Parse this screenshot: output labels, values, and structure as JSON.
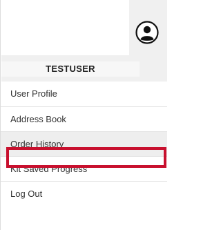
{
  "account": {
    "username": "TESTUSER",
    "avatar_icon": "user-avatar-icon"
  },
  "menu": {
    "items": [
      {
        "label": "User Profile"
      },
      {
        "label": "Address Book"
      },
      {
        "label": "Order History"
      },
      {
        "label": "Kit Saved Progress"
      },
      {
        "label": "Log Out"
      }
    ]
  },
  "colors": {
    "highlight_border": "#c8102e",
    "header_bg": "#f0f0f0"
  }
}
